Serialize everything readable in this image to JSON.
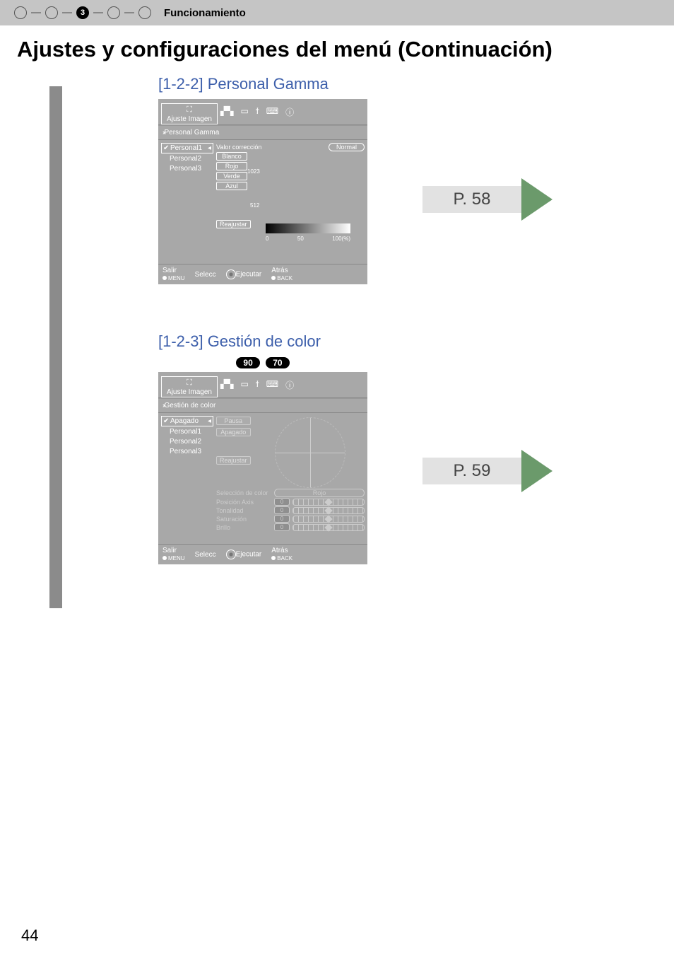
{
  "header": {
    "step_active": "3",
    "section": "Funcionamiento"
  },
  "title": "Ajustes y configuraciones del menú (Continuación)",
  "panel1": {
    "title": "[1-2-2] Personal Gamma",
    "tab": "Ajuste Imagen",
    "crumb": "Personal Gamma",
    "opts": [
      "Personal1",
      "Personal2",
      "Personal3"
    ],
    "r_label_corr": "Valor corrección",
    "r_value": "Normal",
    "btn_white": "Blanco",
    "btn_red": "Rojo",
    "btn_green": "Verde",
    "btn_blue": "Azul",
    "btn_reset": "Reajustar",
    "ymax": "1023",
    "ymid": "512",
    "x0": "0",
    "x50": "50",
    "x100": "100(%)",
    "foot_salir": "Salir",
    "foot_menu": "MENU",
    "foot_selecc": "Selecc",
    "foot_exec": "Ejecutar",
    "foot_atras": "Atrás",
    "foot_back": "BACK",
    "pageref": "P. 58"
  },
  "panel2": {
    "title": "[1-2-3] Gestión de color",
    "badge1": "90",
    "badge2": "70",
    "tab": "Ajuste Imagen",
    "crumb": "Gestión de color",
    "opts": [
      "Apagado",
      "Personal1",
      "Personal2",
      "Personal3"
    ],
    "btn_pause": "Pausa",
    "btn_off": "Apagado",
    "btn_reset": "Reajustar",
    "sel_label": "Selección de color",
    "sel_value": "Rojo",
    "row_axis": "Posición Axis",
    "row_tonal": "Tonalidad",
    "row_sat": "Saturación",
    "row_bri": "Brillo",
    "zero": "0",
    "foot_salir": "Salir",
    "foot_menu": "MENU",
    "foot_selecc": "Selecc",
    "foot_exec": "Ejecutar",
    "foot_atras": "Atrás",
    "foot_back": "BACK",
    "pageref": "P. 59"
  },
  "pagenum": "44"
}
